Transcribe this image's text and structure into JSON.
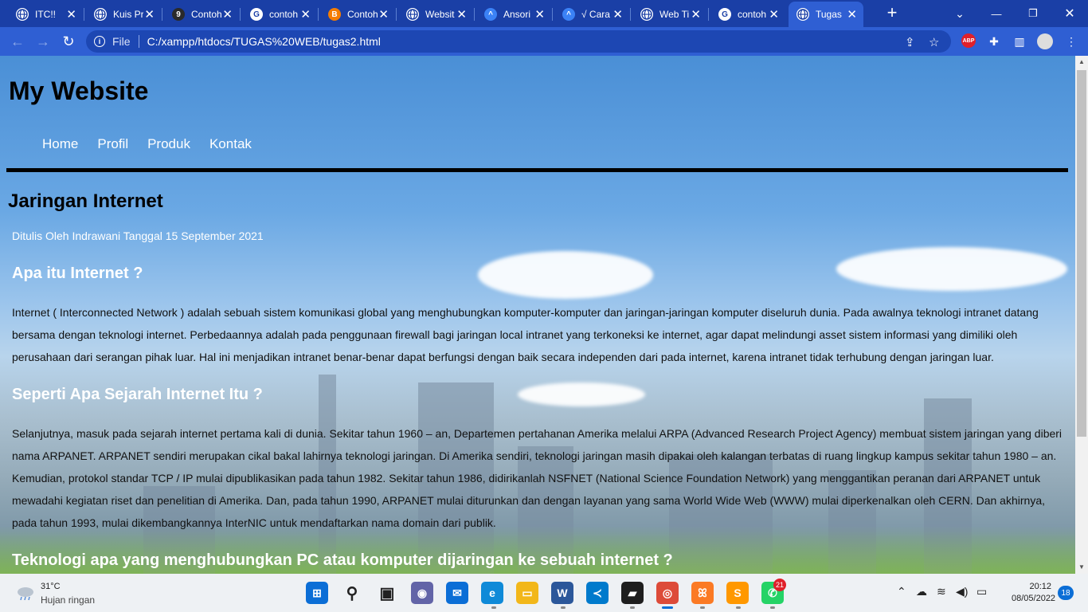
{
  "browser": {
    "tabs": [
      {
        "title": "ITC!!",
        "icon": "globe-icon",
        "fav_color": "#ffffff",
        "fav_text": ""
      },
      {
        "title": "Kuis Pr",
        "icon": "globe-icon",
        "fav_color": "#ffffff",
        "fav_text": ""
      },
      {
        "title": "Contoh",
        "icon": "g9-icon",
        "fav_color": "#2a2a2a",
        "fav_text": "9"
      },
      {
        "title": "contoh",
        "icon": "google-icon",
        "fav_color": "#ffffff",
        "fav_text": "G"
      },
      {
        "title": "Contoh",
        "icon": "blogger-icon",
        "fav_color": "#f57d00",
        "fav_text": "B"
      },
      {
        "title": "Websit",
        "icon": "globe-icon",
        "fav_color": "#ffffff",
        "fav_text": ""
      },
      {
        "title": "Ansori",
        "icon": "site-icon",
        "fav_color": "#3b82f6",
        "fav_text": "^"
      },
      {
        "title": "√ Cara",
        "icon": "site-icon",
        "fav_color": "#3b82f6",
        "fav_text": "^"
      },
      {
        "title": "Web Ti",
        "icon": "globe-icon",
        "fav_color": "#ffffff",
        "fav_text": ""
      },
      {
        "title": "contoh",
        "icon": "google-icon",
        "fav_color": "#ffffff",
        "fav_text": "G"
      },
      {
        "title": "Tugas",
        "icon": "globe-icon",
        "fav_color": "#ffffff",
        "fav_text": "",
        "active": true
      }
    ],
    "address_prefix": "File",
    "url": "C:/xampp/htdocs/TUGAS%20WEB/tugas2.html"
  },
  "page": {
    "site_title": "My Website",
    "nav": [
      "Home",
      "Profil",
      "Produk",
      "Kontak"
    ],
    "article_title": "Jaringan Internet",
    "byline": "Ditulis Oleh Indrawani Tanggal 15 September 2021",
    "sections": [
      {
        "heading": "Apa itu Internet ?",
        "text": "Internet ( Interconnected Network ) adalah sebuah sistem komunikasi global yang menghubungkan komputer-komputer dan jaringan-jaringan komputer diseluruh dunia. Pada awalnya teknologi intranet datang bersama dengan teknologi internet. Perbedaannya adalah pada penggunaan firewall bagi jaringan local intranet yang terkoneksi ke internet, agar dapat melindungi asset sistem informasi yang dimiliki oleh perusahaan dari serangan pihak luar. Hal ini menjadikan intranet benar-benar dapat berfungsi dengan baik secara independen dari pada internet, karena intranet tidak terhubung dengan jaringan luar."
      },
      {
        "heading": "Seperti Apa Sejarah Internet Itu ?",
        "text": "Selanjutnya, masuk pada sejarah internet pertama kali di dunia. Sekitar tahun 1960 – an, Departemen pertahanan Amerika melalui ARPA (Advanced Research Project Agency) membuat sistem jaringan yang diberi nama ARPANET. ARPANET sendiri merupakan cikal bakal lahirnya teknologi jaringan. Di Amerika sendiri, teknologi jaringan masih dipakai oleh kalangan terbatas di ruang lingkup kampus sekitar tahun 1980 – an. Kemudian, protokol standar TCP / IP mulai dipublikasikan pada tahun 1982. Sekitar tahun 1986, didirikanlah NSFNET (National Science Foundation Network) yang menggantikan peranan dari ARPANET untuk mewadahi kegiatan riset dan penelitian di Amerika. Dan, pada tahun 1990, ARPANET mulai diturunkan dan dengan layanan yang sama World Wide Web (WWW) mulai diperkenalkan oleh CERN. Dan akhirnya, pada tahun 1993, mulai dikembangkannya InterNIC untuk mendaftarkan nama domain dari publik."
      },
      {
        "heading": "Teknologi apa yang menghubungkan PC atau komputer dijaringan ke sebuah internet ?",
        "text": ""
      }
    ]
  },
  "taskbar": {
    "weather_temp": "31°C",
    "weather_desc": "Hujan ringan",
    "apps": [
      {
        "name": "start-button",
        "glyph": "⊞",
        "color": "#0b6ed6"
      },
      {
        "name": "search-icon",
        "glyph": "⚲",
        "color": "#222222"
      },
      {
        "name": "task-view-icon",
        "glyph": "▣",
        "color": "#222222"
      },
      {
        "name": "teams-chat-icon",
        "glyph": "◉",
        "color": "#6264a7"
      },
      {
        "name": "mail-icon",
        "glyph": "✉",
        "color": "#0b6ed6"
      },
      {
        "name": "edge-icon",
        "glyph": "e",
        "color": "#0f8ad8"
      },
      {
        "name": "file-explorer-icon",
        "glyph": "▭",
        "color": "#f2b71a"
      },
      {
        "name": "word-icon",
        "glyph": "W",
        "color": "#2b579a"
      },
      {
        "name": "vscode-icon",
        "glyph": "≺",
        "color": "#007acc"
      },
      {
        "name": "sticky-notes-icon",
        "glyph": "▰",
        "color": "#1e1e1e"
      },
      {
        "name": "chrome-icon",
        "glyph": "◎",
        "color": "#dd4b39"
      },
      {
        "name": "xampp-icon",
        "glyph": "ꕤ",
        "color": "#fb7a24"
      },
      {
        "name": "sublime-icon",
        "glyph": "S",
        "color": "#ff9800"
      },
      {
        "name": "whatsapp-icon",
        "glyph": "✆",
        "color": "#25d366"
      }
    ],
    "whatsapp_badge": "21",
    "time": "20:12",
    "date": "08/05/2022",
    "notifications": "18"
  },
  "colors": {
    "tabstrip": "#1a3fa6",
    "toolbar": "#2f5fd3",
    "heading_dark": "#000000",
    "heading_light": "#ffffff"
  }
}
